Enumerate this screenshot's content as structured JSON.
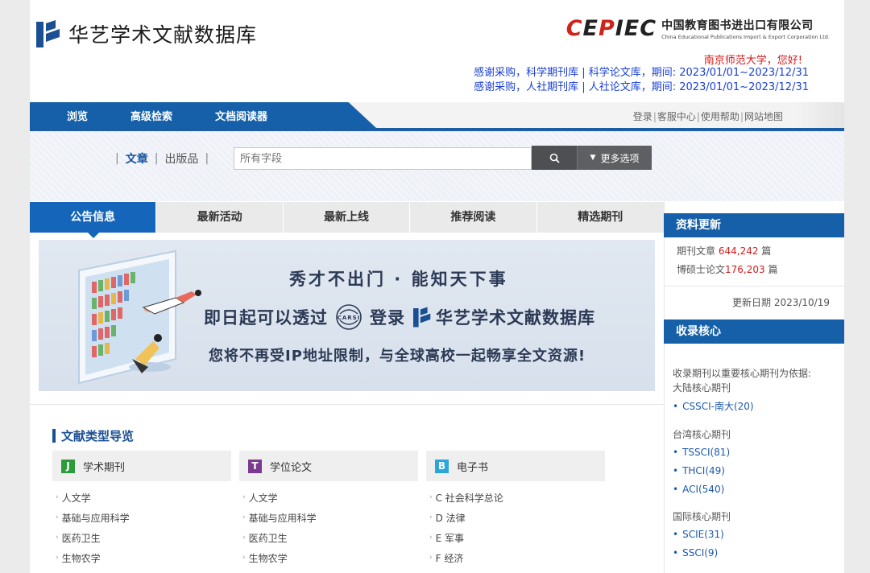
{
  "header": {
    "logo_title": "华艺学术文献数据库",
    "cepiec_brand": "CEPIEC",
    "cepiec_cn": "中国教育图书进出口有限公司",
    "cepiec_en": "China Educational Publications Import & Export Corporation Ltd.",
    "greeting": "南京师范大学，您好!",
    "thanks_1": "感谢采购，科学期刊库 | 科学论文库，期间: 2023/01/01~2023/12/31",
    "thanks_2": "感谢采购，人社期刊库 | 人社论文库，期间: 2023/01/01~2023/12/31"
  },
  "nav": {
    "items": [
      "浏览",
      "高级检索",
      "文档阅读器"
    ],
    "links": [
      "登录",
      "客服中心",
      "使用帮助",
      "网站地图"
    ]
  },
  "search": {
    "tab_article": "文章",
    "tab_publication": "出版品",
    "placeholder": "所有字段",
    "more_label": "更多选项"
  },
  "tabs": [
    "公告信息",
    "最新活动",
    "最新上线",
    "推荐阅读",
    "精选期刊"
  ],
  "banner": {
    "line1": "秀才不出门 · 能知天下事",
    "line2_prefix": "即日起可以透过",
    "line2_carsi": "CARSI",
    "line2_mid": "登录",
    "line2_brand": "华艺学术文献数据库",
    "line3": "您将不再受IP地址限制，与全球高校一起畅享全文资源!"
  },
  "doc_types": {
    "title": "文献类型导览",
    "columns": [
      {
        "badge": "J",
        "color": "#2e9a3c",
        "label": "学术期刊",
        "items": [
          "人文学",
          "基础与应用科学",
          "医药卫生",
          "生物农学"
        ]
      },
      {
        "badge": "T",
        "color": "#7a3b8f",
        "label": "学位论文",
        "items": [
          "人文学",
          "基础与应用科学",
          "医药卫生",
          "生物农学"
        ]
      },
      {
        "badge": "B",
        "color": "#2aa6d8",
        "label": "电子书",
        "items": [
          "C 社会科学总论",
          "D 法律",
          "E 军事",
          "F 经济"
        ]
      }
    ]
  },
  "sidebar": {
    "update_title": "资料更新",
    "journal_label": "期刊文章",
    "journal_count": "644,242",
    "thesis_label": "博硕士论文",
    "thesis_count": "176,203",
    "unit": "篇",
    "update_date": "更新日期 2023/10/19",
    "core_title": "收录核心",
    "core_intro": "收录期刊以重要核心期刊为依据:",
    "mainland": "大陆核心期刊",
    "mainland_items": [
      "CSSCI-南大(20)"
    ],
    "taiwan": "台湾核心期刊",
    "taiwan_items": [
      "TSSCI(81)",
      "THCI(49)",
      "ACI(540)"
    ],
    "intl": "国际核心期刊",
    "intl_items": [
      "SCIE(31)",
      "SSCI(9)"
    ]
  }
}
